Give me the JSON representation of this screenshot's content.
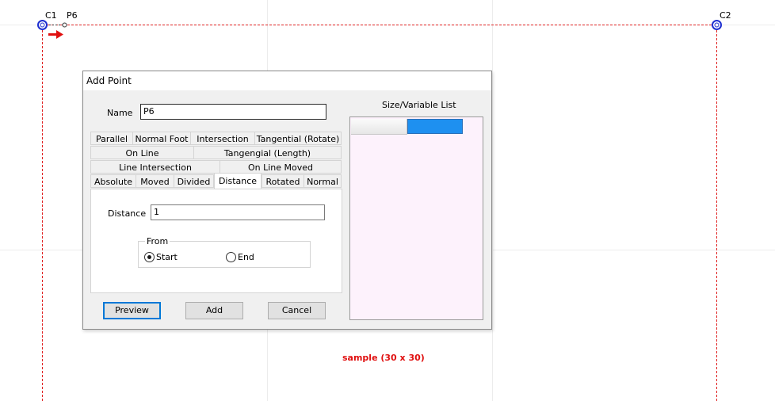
{
  "canvas": {
    "point_labels": [
      "C1",
      "P6",
      "C2"
    ],
    "sample_label": "sample (30 x 30)",
    "colors": {
      "guide": "#e02020",
      "point": "#1e2fd0",
      "sample": "#e01010"
    }
  },
  "dialog": {
    "title": "Add Point",
    "name_label": "Name",
    "name_value": "P6",
    "tabs": {
      "row1": [
        "Parallel",
        "Normal Foot",
        "Intersection",
        "Tangential (Rotate)"
      ],
      "row2": [
        "On Line",
        "Tangengial (Length)"
      ],
      "row3": [
        "Line Intersection",
        "On Line Moved"
      ],
      "row4": [
        "Absolute",
        "Moved",
        "Divided",
        "Distance",
        "Rotated",
        "Normal"
      ],
      "active": "Distance"
    },
    "distance_label": "Distance",
    "distance_value": "1",
    "from_group": {
      "title": "From",
      "options": [
        "Start",
        "End"
      ],
      "selected": "Start"
    },
    "buttons": {
      "preview": "Preview",
      "add": "Add",
      "cancel": "Cancel"
    },
    "list": {
      "title": "Size/Variable List",
      "colors": {
        "background": "#fdf2fc",
        "selected_column": "#1e90f0"
      }
    }
  }
}
